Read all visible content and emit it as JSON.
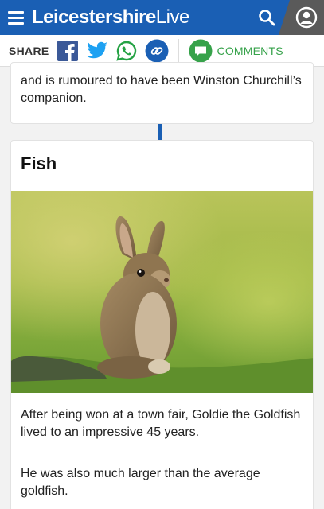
{
  "header": {
    "logo_main": "Leicestershire",
    "logo_suffix": "Live",
    "brand_color": "#1a5fb4"
  },
  "share_bar": {
    "share_label": "SHARE",
    "comments_label": "COMMENTS",
    "icons": [
      "facebook-icon",
      "twitter-icon",
      "whatsapp-icon",
      "link-icon",
      "comment-bubble-icon"
    ]
  },
  "previous_item": {
    "text_fragment": "and is rumoured to have been Winston Churchill’s companion."
  },
  "item": {
    "title": "Fish",
    "paragraphs": [
      "After being won at a town fair, Goldie the Goldfish lived to an impressive 45 years.",
      "He was also much larger than the average goldfish."
    ]
  }
}
